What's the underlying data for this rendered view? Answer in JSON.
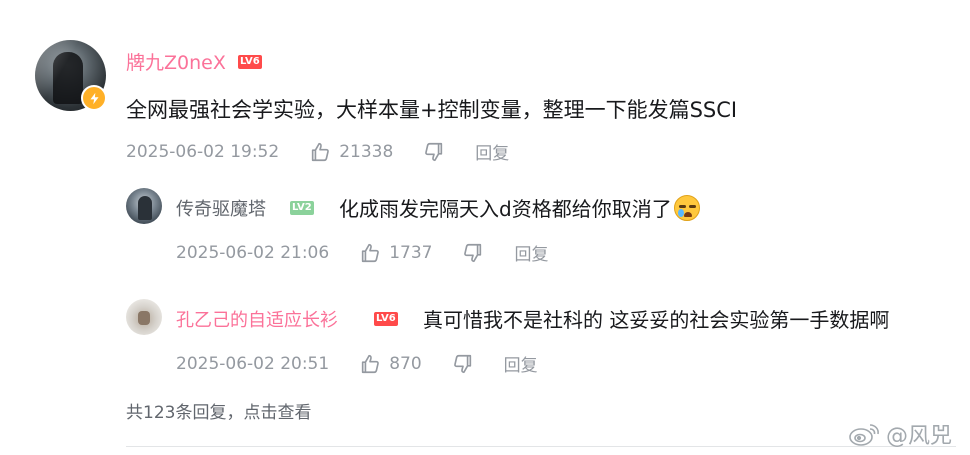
{
  "main_comment": {
    "username": "牌九Z0neX",
    "level": "LV6",
    "text": "全网最强社会学实验，大样本量+控制变量，整理一下能发篇SSCI",
    "time": "2025-06-02 19:52",
    "likes": "21338",
    "reply_label": "回复"
  },
  "replies": [
    {
      "username": "传奇驱魔塔",
      "level": "LV2",
      "text": "化成雨发完隔天入d资格都给你取消了",
      "time": "2025-06-02 21:06",
      "likes": "1737",
      "reply_label": "回复"
    },
    {
      "username": "孔乙己的自适应长衫",
      "level": "LV6",
      "text": "真可惜我不是社科的 这妥妥的社会实验第一手数据啊",
      "time": "2025-06-02 20:51",
      "likes": "870",
      "reply_label": "回复"
    }
  ],
  "more_replies": "共123条回复，点击查看",
  "watermark": "@风兕",
  "colors": {
    "vip_name": "#fb7299",
    "normal_name": "#61666d",
    "meta_text": "#9499a0",
    "lv6_badge": "#ff4a4a",
    "lv2_badge": "#8bd29b",
    "bolt_badge": "#ffb027"
  },
  "icons": [
    "avatar",
    "bolt-icon",
    "thumbs-up-icon",
    "thumbs-down-icon",
    "crying-emoji",
    "weibo-icon"
  ]
}
